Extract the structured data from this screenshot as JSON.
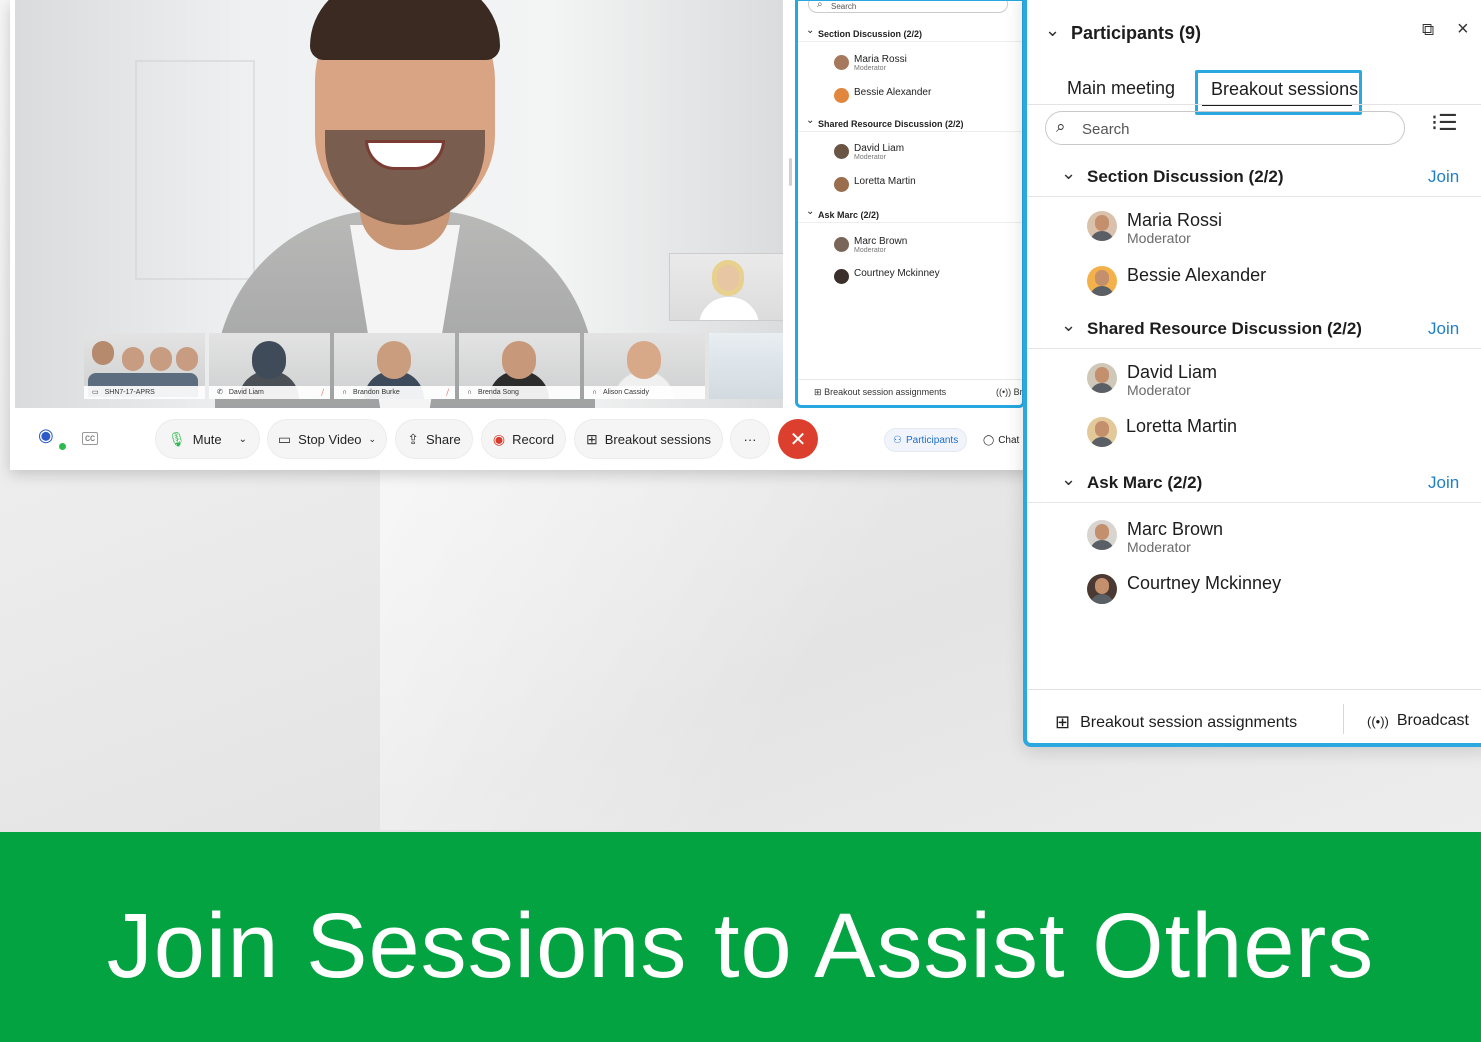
{
  "banner": {
    "headline": "Join Sessions to Assist Others"
  },
  "video": {
    "tiles": [
      {
        "label": "SHN7-17-APRS",
        "icon": "room-icon"
      },
      {
        "label": "David Liam",
        "icon": "phone-icon",
        "muted": true
      },
      {
        "label": "Brandon Burke",
        "icon": "headset-icon",
        "muted": true
      },
      {
        "label": "Brenda Song",
        "icon": "headset-icon"
      },
      {
        "label": "Alison Cassidy",
        "icon": "headset-icon"
      }
    ]
  },
  "controls": {
    "mute": "Mute",
    "stop_video": "Stop Video",
    "share": "Share",
    "record": "Record",
    "breakout": "Breakout sessions",
    "more": "···",
    "participants_tab": "Participants",
    "chat_tab": "Chat"
  },
  "mini_panel": {
    "search_placeholder": "Search",
    "sections": [
      {
        "name": "Section Discussion (2/2)",
        "people": [
          {
            "name": "Maria Rossi",
            "role": "Moderator"
          },
          {
            "name": "Bessie Alexander",
            "role": ""
          }
        ]
      },
      {
        "name": "Shared Resource Discussion (2/2)",
        "people": [
          {
            "name": "David Liam",
            "role": "Moderator"
          },
          {
            "name": "Loretta Martin",
            "role": ""
          }
        ]
      },
      {
        "name": "Ask Marc (2/2)",
        "people": [
          {
            "name": "Marc Brown",
            "role": "Moderator"
          },
          {
            "name": "Courtney Mckinney",
            "role": ""
          }
        ]
      }
    ],
    "footer_assign": "Breakout session assignments",
    "footer_broadcast": "Br"
  },
  "panel": {
    "title": "Participants (9)",
    "tabs": {
      "main": "Main meeting",
      "breakout": "Breakout sessions"
    },
    "search_placeholder": "Search",
    "join_label": "Join",
    "sections": [
      {
        "name": "Section Discussion (2/2)",
        "people": [
          {
            "name": "Maria Rossi",
            "role": "Moderator"
          },
          {
            "name": "Bessie Alexander",
            "role": ""
          }
        ]
      },
      {
        "name": "Shared Resource Discussion (2/2)",
        "people": [
          {
            "name": "David Liam",
            "role": "Moderator"
          },
          {
            "name": "Loretta Martin",
            "role": ""
          }
        ]
      },
      {
        "name": "Ask Marc (2/2)",
        "people": [
          {
            "name": "Marc Brown",
            "role": "Moderator"
          },
          {
            "name": "Courtney Mckinney",
            "role": ""
          }
        ]
      }
    ],
    "footer": {
      "assignments": "Breakout session assignments",
      "broadcast": "Broadcast"
    }
  },
  "colors": {
    "accent": "#2ba8e0",
    "link": "#1f7fc8",
    "banner": "#04a342",
    "hangup": "#dc3f2d"
  }
}
